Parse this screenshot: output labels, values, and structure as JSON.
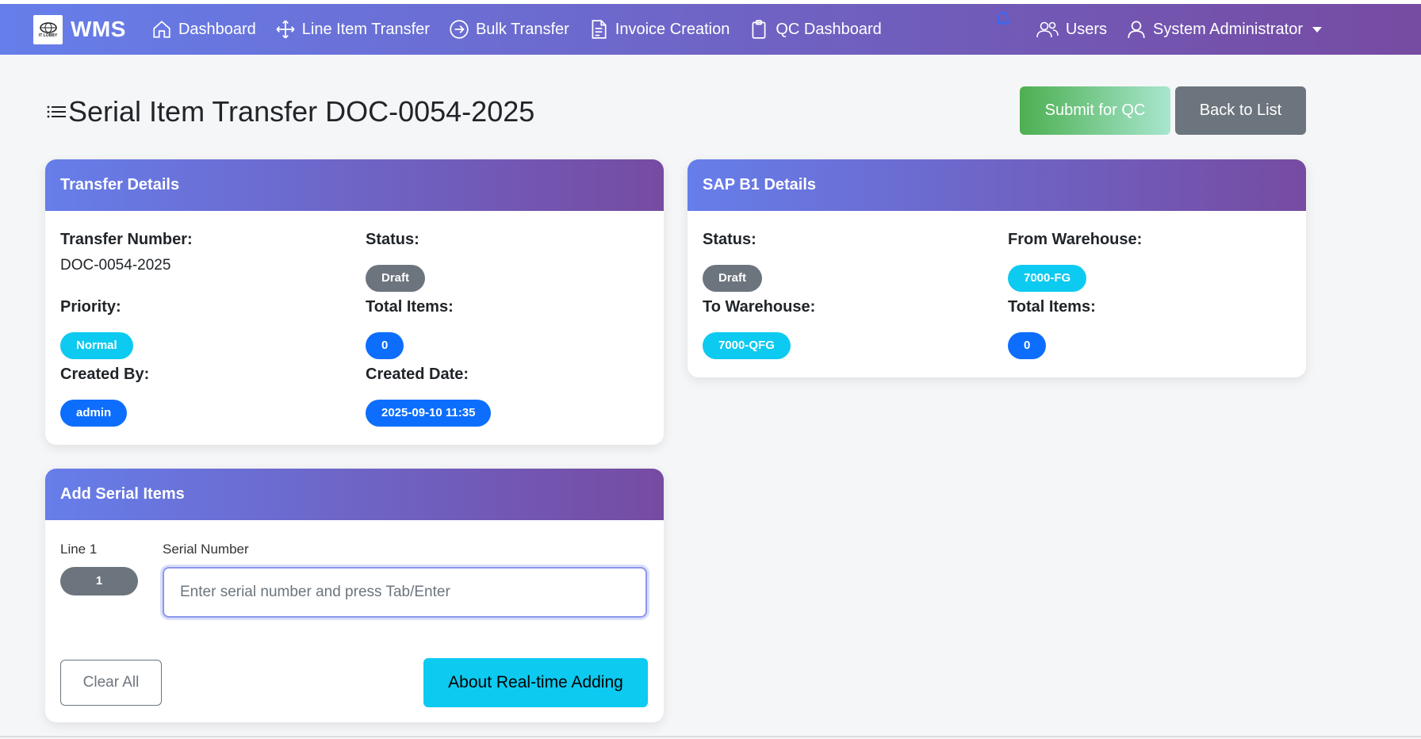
{
  "navbar": {
    "brand": "WMS",
    "logo_text": "IT LOBBY",
    "links": [
      {
        "label": "Dashboard",
        "icon": "home-icon"
      },
      {
        "label": "Line Item Transfer",
        "icon": "move-arrows-icon"
      },
      {
        "label": "Bulk Transfer",
        "icon": "arrow-circle-right-icon"
      },
      {
        "label": "Invoice Creation",
        "icon": "document-icon"
      },
      {
        "label": "QC Dashboard",
        "icon": "clipboard-icon"
      }
    ],
    "users_label": "Users",
    "admin_label": "System Administrator"
  },
  "page": {
    "title": "Serial Item Transfer DOC-0054-2025",
    "submit_label": "Submit for QC",
    "back_label": "Back to List"
  },
  "transfer_details": {
    "header": "Transfer Details",
    "transfer_number_label": "Transfer Number:",
    "transfer_number": "DOC-0054-2025",
    "status_label": "Status:",
    "status": "Draft",
    "priority_label": "Priority:",
    "priority": "Normal",
    "total_items_label": "Total Items:",
    "total_items": "0",
    "created_by_label": "Created By:",
    "created_by": "admin",
    "created_date_label": "Created Date:",
    "created_date": "2025-09-10 11:35"
  },
  "sap_details": {
    "header": "SAP B1 Details",
    "status_label": "Status:",
    "status": "Draft",
    "from_warehouse_label": "From Warehouse:",
    "from_warehouse": "7000-FG",
    "to_warehouse_label": "To Warehouse:",
    "to_warehouse": "7000-QFG",
    "total_items_label": "Total Items:",
    "total_items": "0"
  },
  "add_serial": {
    "header": "Add Serial Items",
    "line_label": "Line 1",
    "line_number": "1",
    "serial_label": "Serial Number",
    "serial_placeholder": "Enter serial number and press Tab/Enter",
    "clear_label": "Clear All",
    "about_label": "About Real-time Adding"
  },
  "colors": {
    "gradient_start": "#667eea",
    "gradient_end": "#764ba2",
    "badge_gray": "#6c757d",
    "badge_cyan": "#0dcaf0",
    "badge_blue": "#0d6efd"
  }
}
